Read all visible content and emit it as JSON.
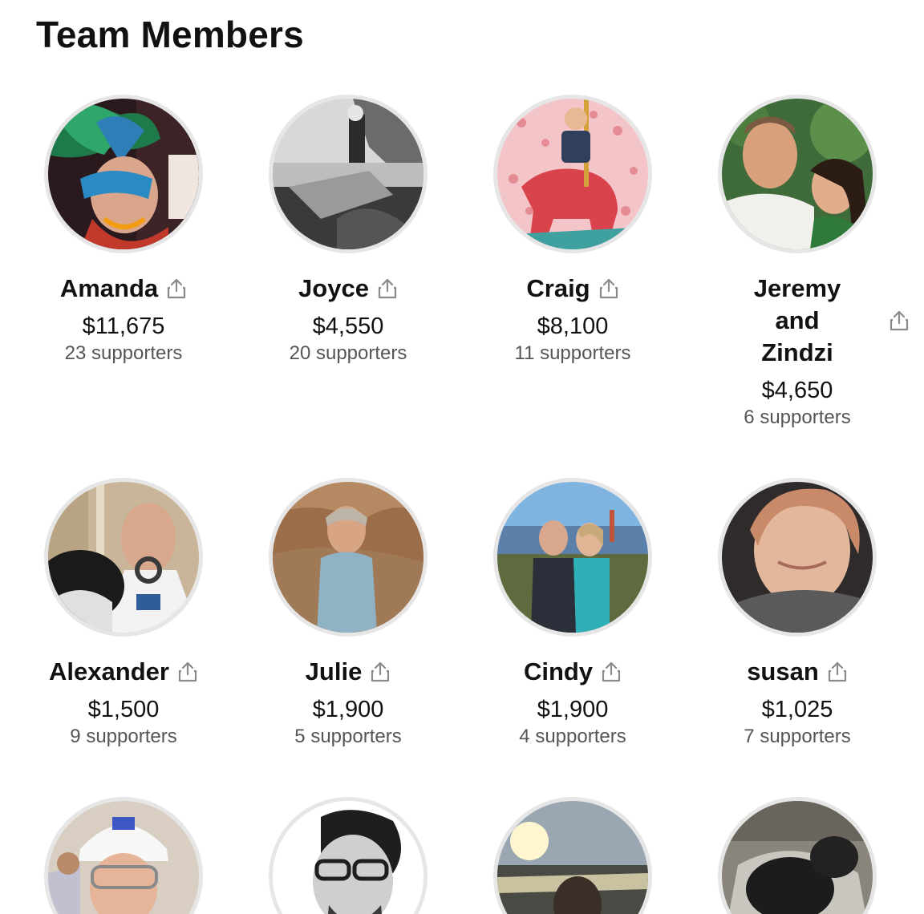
{
  "page": {
    "title": "Team Members"
  },
  "members": [
    {
      "name": "Amanda",
      "amount": "$11,675",
      "supporters": "23 supporters",
      "avatar": "photo-masquerade",
      "share_icon": "share-icon"
    },
    {
      "name": "Joyce",
      "amount": "$4,550",
      "supporters": "20 supporters",
      "avatar": "photo-beach-bw",
      "share_icon": "share-icon"
    },
    {
      "name": "Craig",
      "amount": "$8,100",
      "supporters": "11 supporters",
      "avatar": "photo-elephant-ride",
      "share_icon": "share-icon"
    },
    {
      "name": "Jeremy and Zindzi",
      "amount": "$4,650",
      "supporters": "6 supporters",
      "avatar": "photo-couple",
      "share_icon": "share-icon"
    },
    {
      "name": "Alexander",
      "amount": "$1,500",
      "supporters": "9 supporters",
      "avatar": "photo-space-suit",
      "share_icon": "share-icon"
    },
    {
      "name": "Julie",
      "amount": "$1,900",
      "supporters": "5 supporters",
      "avatar": "photo-canyon",
      "share_icon": "share-icon"
    },
    {
      "name": "Cindy",
      "amount": "$1,900",
      "supporters": "4 supporters",
      "avatar": "photo-golden-gate",
      "share_icon": "share-icon"
    },
    {
      "name": "susan",
      "amount": "$1,025",
      "supporters": "7 supporters",
      "avatar": "photo-portrait",
      "share_icon": "share-icon"
    },
    {
      "avatar": "photo-hard-hat"
    },
    {
      "avatar": "photo-glasses-bw"
    },
    {
      "avatar": "photo-sunset-sea"
    },
    {
      "avatar": "photo-dog"
    }
  ],
  "colors": {
    "avatar_ring": "#e6e6e6",
    "text_primary": "#111111",
    "text_secondary": "#555555",
    "share_icon": "#8a8a8a"
  }
}
